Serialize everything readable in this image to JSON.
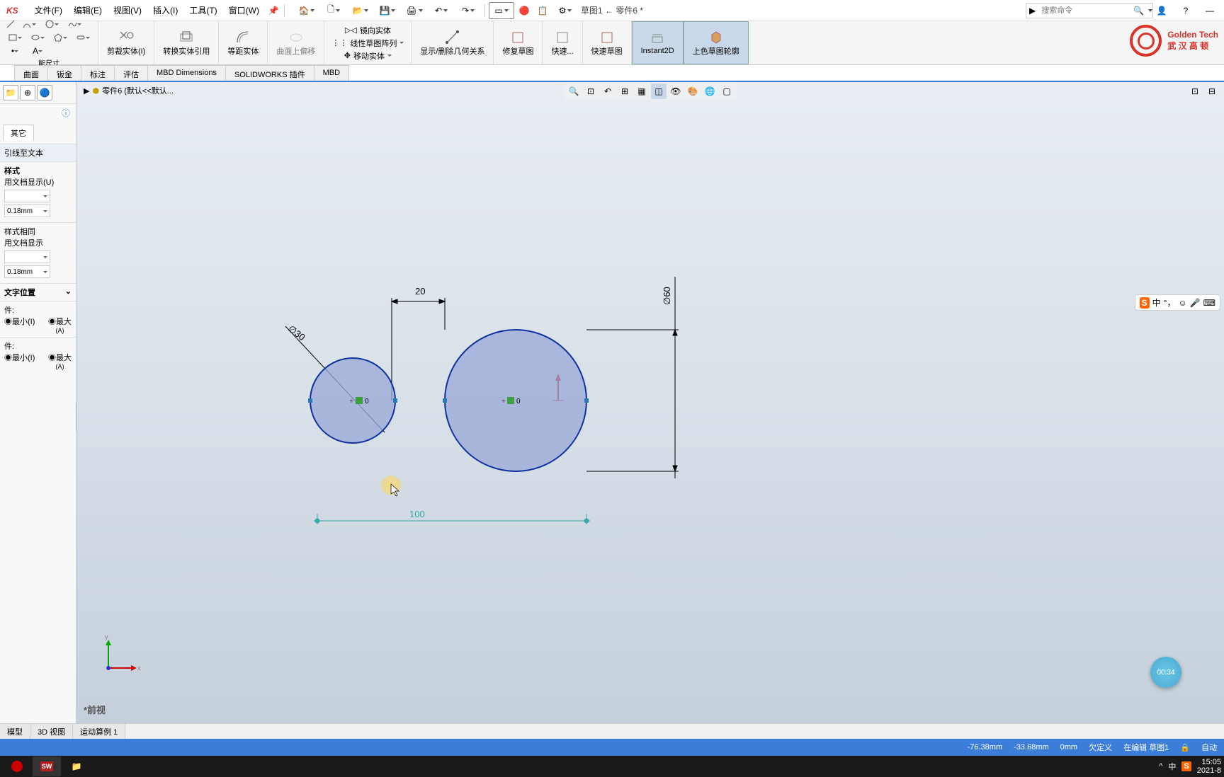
{
  "app": {
    "name": "KS"
  },
  "menu": {
    "file": "文件(F)",
    "edit": "编辑(E)",
    "view": "视图(V)",
    "insert": "插入(I)",
    "tools": "工具(T)",
    "window": "窗口(W)"
  },
  "doc_title": "草图1 ← 零件6 *",
  "search": {
    "placeholder": "搜索命令"
  },
  "ribbon": {
    "smart_dim": "能尺寸",
    "trim": "剪裁实体(I)",
    "convert": "转换实体引用",
    "offset": "等距实体",
    "surface_offset": "曲面上偏移",
    "mirror": "镜向实体",
    "linear_pattern": "线性草图阵列",
    "move": "移动实体",
    "display_relations": "显示/删除几何关系",
    "repair": "修复草图",
    "quick_snap": "快速...",
    "rapid": "快速草图",
    "instant2d": "Instant2D",
    "shaded": "上色草图轮廓"
  },
  "tabs": {
    "surface": "曲面",
    "sheetmetal": "钣金",
    "annotate": "标注",
    "evaluate": "评估",
    "mbd_dim": "MBD Dimensions",
    "sw_plugins": "SOLIDWORKS 插件",
    "mbd": "MBD"
  },
  "breadcrumb": {
    "part": "零件6 (默认<<默认..."
  },
  "panel": {
    "tab_other": "其它",
    "leader_to_text": "引线至文本",
    "style": "样式",
    "use_doc1": "用文档显示(U)",
    "val1": "0.18mm",
    "same_style": "样式相同",
    "use_doc2": "用文档显示",
    "val2": "0.18mm",
    "text_pos": "文字位置",
    "cond": "件:",
    "min": "最小(I)",
    "max": "最大",
    "a": "(A)"
  },
  "sketch_dims": {
    "d30": "∅30",
    "d60": "∅60",
    "gap20": "20",
    "dist100": "100",
    "o1": "0",
    "o2": "0"
  },
  "view_label": "*前视",
  "bottom_tabs": {
    "model": "模型",
    "view3d": "3D 视图",
    "motion": "运动算例 1"
  },
  "status": {
    "x": "-76.38mm",
    "y": "-33.68mm",
    "z": "0mm",
    "defined": "欠定义",
    "editing": "在编辑 草图1",
    "auto": "自动"
  },
  "logo": {
    "line1": "Golden Tech",
    "line2": "武 汉 高 顿"
  },
  "ime": {
    "lang": "中"
  },
  "timer": "00:34",
  "clock": {
    "time": "15:05",
    "date": "2021-8"
  },
  "systray": {
    "lang": "中"
  }
}
